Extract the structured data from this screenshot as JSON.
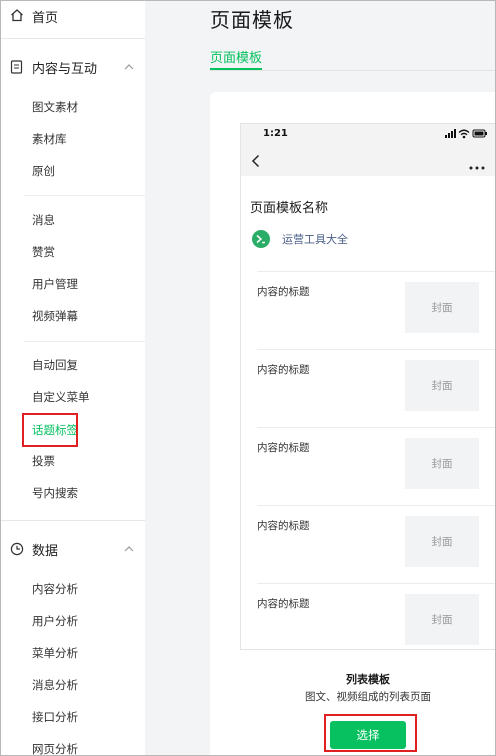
{
  "sidebar": {
    "home": "首页",
    "section_content": "内容与互动",
    "group1": [
      "图文素材",
      "素材库",
      "原创"
    ],
    "group2": [
      "消息",
      "赞赏",
      "用户管理",
      "视频弹幕"
    ],
    "group3": [
      "自动回复",
      "自定义菜单",
      "话题标签",
      "投票",
      "号内搜索"
    ],
    "active_item": "话题标签",
    "section_data": "数据",
    "group4": [
      "内容分析",
      "用户分析",
      "菜单分析",
      "消息分析",
      "接口分析",
      "网页分析"
    ]
  },
  "main": {
    "page_title": "页面模板",
    "tab_label": "页面模板"
  },
  "preview": {
    "status_time": "1:21",
    "template_name": "页面模板名称",
    "account_name": "运营工具大全",
    "items": [
      {
        "title": "内容的标题",
        "cover": "封面"
      },
      {
        "title": "内容的标题",
        "cover": "封面"
      },
      {
        "title": "内容的标题",
        "cover": "封面"
      },
      {
        "title": "内容的标题",
        "cover": "封面"
      },
      {
        "title": "内容的标题",
        "cover": "封面"
      }
    ]
  },
  "template": {
    "label": "列表模板",
    "description": "图文、视频组成的列表页面",
    "select_button": "选择"
  },
  "colors": {
    "accent": "#07c160",
    "highlight": "#e02020",
    "link": "#4a5e86"
  },
  "icons": {
    "home": "home-icon",
    "content": "document-icon",
    "data": "clock-icon",
    "collapse": "chevron-up-icon",
    "back": "chevron-left-icon",
    "more": "more-icon",
    "signal": "signal-icon",
    "wifi": "wifi-icon",
    "battery": "battery-icon"
  }
}
